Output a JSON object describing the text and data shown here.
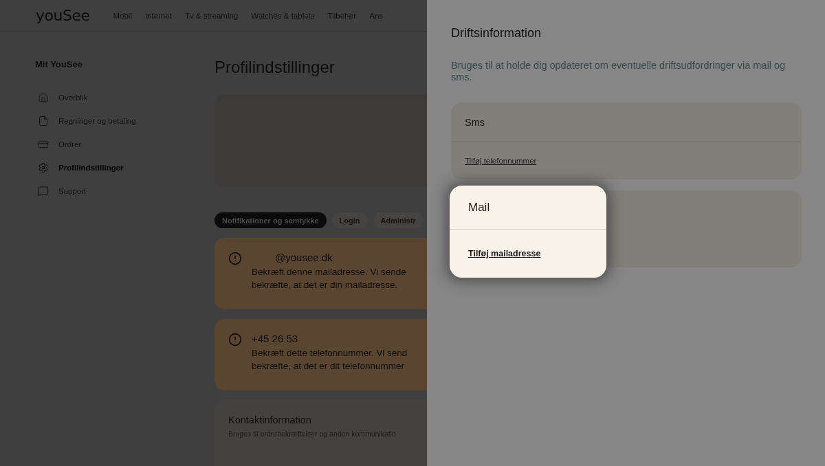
{
  "header": {
    "logo": "youSee",
    "nav": [
      "Mobil",
      "Internet",
      "Tv & streaming",
      "Watches & tablets",
      "Tilbehør",
      "Ans"
    ]
  },
  "sidebar": {
    "title": "Mit YouSee",
    "items": [
      {
        "label": "Overblik",
        "kind": "home",
        "selected": false
      },
      {
        "label": "Regninger og betaling",
        "kind": "file",
        "selected": false
      },
      {
        "label": "Ordrer",
        "kind": "card",
        "selected": false
      },
      {
        "label": "Profilindstillinger",
        "kind": "gear",
        "selected": true
      },
      {
        "label": "Support",
        "kind": "chat",
        "selected": false
      }
    ]
  },
  "main": {
    "title": "Profilindstillinger",
    "tabs": [
      {
        "label": "Notifikationer og samtykke",
        "selected": true
      },
      {
        "label": "Login",
        "selected": false
      },
      {
        "label": "Administr",
        "selected": false
      }
    ],
    "alerts": [
      {
        "heading": "@yousee.dk",
        "lines": [
          "Bekræft denne mailadresse. Vi sende",
          "bekræfte, at det er din mailadresse."
        ]
      },
      {
        "heading": "+45 26 53",
        "lines": [
          "Bekræft dette telefonnummer. Vi send",
          "bekræfte, at det er dit telefonnummer"
        ]
      }
    ],
    "contact": {
      "title": "Kontaktinformation",
      "subtitle": "Bruges til ordrebekræftelser og anden kommunikatio"
    }
  },
  "panel": {
    "title": "Driftsinformation",
    "description": "Bruges til at holde dig opdateret om eventuelle driftsudfordringer via mail og sms.",
    "cards": [
      {
        "title": "Sms",
        "link": "Tilføj telefonnummer",
        "highlighted": false
      },
      {
        "title": "Mail",
        "link": "Tilføj mailadresse",
        "highlighted": true
      }
    ]
  }
}
